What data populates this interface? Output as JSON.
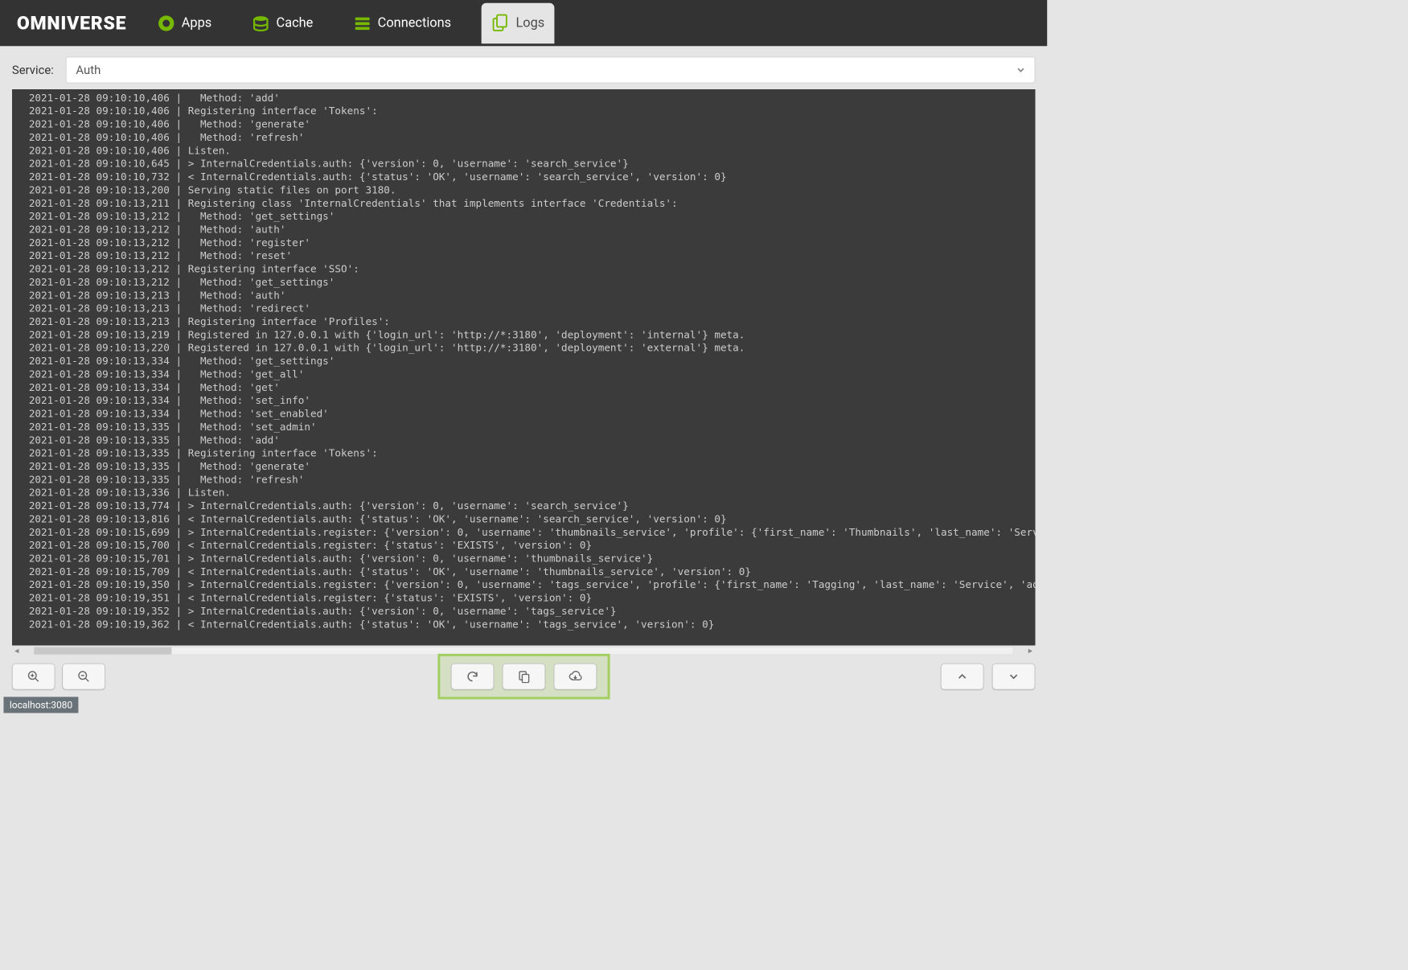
{
  "brand": "OMNIVERSE",
  "tabs": [
    {
      "label": "Apps",
      "icon": "apps"
    },
    {
      "label": "Cache",
      "icon": "cache"
    },
    {
      "label": "Connections",
      "icon": "connections"
    },
    {
      "label": "Logs",
      "icon": "logs",
      "active": true
    }
  ],
  "service": {
    "label": "Service:",
    "value": "Auth"
  },
  "log_lines": [
    "2021-01-28 09:10:10,406 |   Method: 'add'",
    "2021-01-28 09:10:10,406 | Registering interface 'Tokens':",
    "2021-01-28 09:10:10,406 |   Method: 'generate'",
    "2021-01-28 09:10:10,406 |   Method: 'refresh'",
    "2021-01-28 09:10:10,406 | Listen.",
    "2021-01-28 09:10:10,645 | > InternalCredentials.auth: {'version': 0, 'username': 'search_service'}",
    "2021-01-28 09:10:10,732 | < InternalCredentials.auth: {'status': 'OK', 'username': 'search_service', 'version': 0}",
    "2021-01-28 09:10:13,200 | Serving static files on port 3180.",
    "2021-01-28 09:10:13,211 | Registering class 'InternalCredentials' that implements interface 'Credentials':",
    "2021-01-28 09:10:13,212 |   Method: 'get_settings'",
    "2021-01-28 09:10:13,212 |   Method: 'auth'",
    "2021-01-28 09:10:13,212 |   Method: 'register'",
    "2021-01-28 09:10:13,212 |   Method: 'reset'",
    "2021-01-28 09:10:13,212 | Registering interface 'SSO':",
    "2021-01-28 09:10:13,212 |   Method: 'get_settings'",
    "2021-01-28 09:10:13,213 |   Method: 'auth'",
    "2021-01-28 09:10:13,213 |   Method: 'redirect'",
    "2021-01-28 09:10:13,213 | Registering interface 'Profiles':",
    "2021-01-28 09:10:13,219 | Registered in 127.0.0.1 with {'login_url': 'http://*:3180', 'deployment': 'internal'} meta.",
    "2021-01-28 09:10:13,220 | Registered in 127.0.0.1 with {'login_url': 'http://*:3180', 'deployment': 'external'} meta.",
    "2021-01-28 09:10:13,334 |   Method: 'get_settings'",
    "2021-01-28 09:10:13,334 |   Method: 'get_all'",
    "2021-01-28 09:10:13,334 |   Method: 'get'",
    "2021-01-28 09:10:13,334 |   Method: 'set_info'",
    "2021-01-28 09:10:13,334 |   Method: 'set_enabled'",
    "2021-01-28 09:10:13,335 |   Method: 'set_admin'",
    "2021-01-28 09:10:13,335 |   Method: 'add'",
    "2021-01-28 09:10:13,335 | Registering interface 'Tokens':",
    "2021-01-28 09:10:13,335 |   Method: 'generate'",
    "2021-01-28 09:10:13,335 |   Method: 'refresh'",
    "2021-01-28 09:10:13,336 | Listen.",
    "2021-01-28 09:10:13,774 | > InternalCredentials.auth: {'version': 0, 'username': 'search_service'}",
    "2021-01-28 09:10:13,816 | < InternalCredentials.auth: {'status': 'OK', 'username': 'search_service', 'version': 0}",
    "2021-01-28 09:10:15,699 | > InternalCredentials.register: {'version': 0, 'username': 'thumbnails_service', 'profile': {'first_name': 'Thumbnails', 'last_name': 'Servic",
    "2021-01-28 09:10:15,700 | < InternalCredentials.register: {'status': 'EXISTS', 'version': 0}",
    "2021-01-28 09:10:15,701 | > InternalCredentials.auth: {'version': 0, 'username': 'thumbnails_service'}",
    "2021-01-28 09:10:15,709 | < InternalCredentials.auth: {'status': 'OK', 'username': 'thumbnails_service', 'version': 0}",
    "2021-01-28 09:10:19,350 | > InternalCredentials.register: {'version': 0, 'username': 'tags_service', 'profile': {'first_name': 'Tagging', 'last_name': 'Service', 'admi",
    "2021-01-28 09:10:19,351 | < InternalCredentials.register: {'status': 'EXISTS', 'version': 0}",
    "2021-01-28 09:10:19,352 | > InternalCredentials.auth: {'version': 0, 'username': 'tags_service'}",
    "2021-01-28 09:10:19,362 | < InternalCredentials.auth: {'status': 'OK', 'username': 'tags_service', 'version': 0}"
  ],
  "status": "localhost:3080"
}
